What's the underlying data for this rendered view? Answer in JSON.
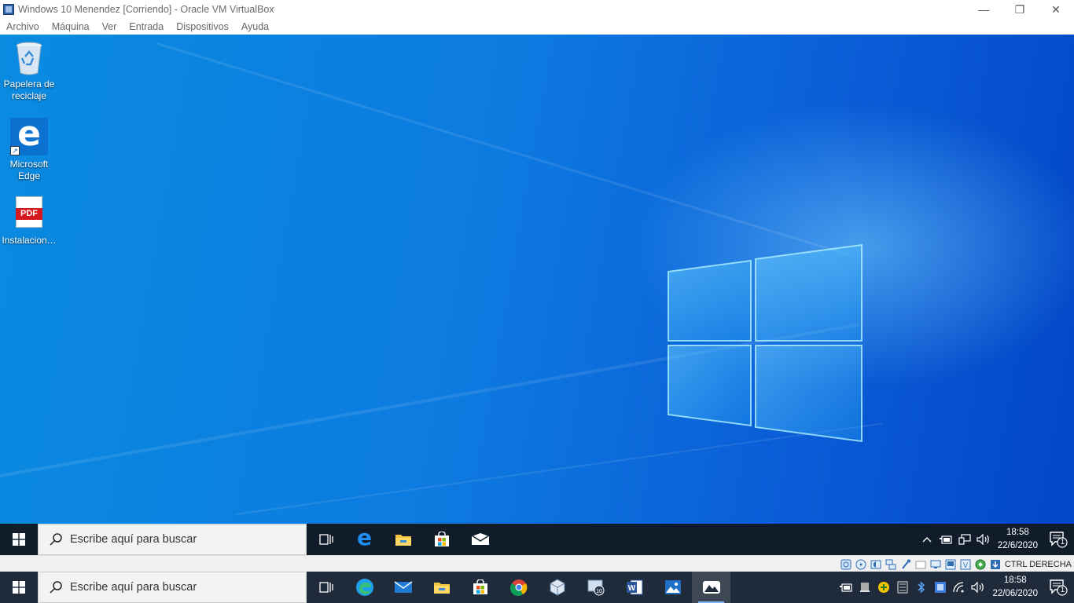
{
  "window": {
    "title": "Windows 10 Menendez [Corriendo] - Oracle VM VirtualBox",
    "controls": {
      "minimize": "—",
      "restore": "❐",
      "close": "✕"
    }
  },
  "menu": {
    "items": [
      "Archivo",
      "Máquina",
      "Ver",
      "Entrada",
      "Dispositivos",
      "Ayuda"
    ]
  },
  "desktop": {
    "icons": [
      {
        "label_line1": "Papelera de",
        "label_line2": "reciclaje",
        "icon": "recycle-bin-icon"
      },
      {
        "label_line1": "Microsoft",
        "label_line2": "Edge",
        "icon": "edge-icon"
      },
      {
        "label_line1": "Instalacion…",
        "label_line2": "",
        "icon": "pdf-icon",
        "badge": "PDF"
      }
    ],
    "colors": {
      "accent": "#0a78e0"
    }
  },
  "guest_taskbar": {
    "search_placeholder": "Escribe aquí para buscar",
    "apps": [
      "task-view-icon",
      "edge-icon",
      "file-explorer-icon",
      "store-icon",
      "mail-icon"
    ],
    "time": "18:58",
    "date": "22/6/2020",
    "notifications": "1"
  },
  "statusbar": {
    "host_key": "CTRL DERECHA"
  },
  "host_taskbar": {
    "search_placeholder": "Escribe aquí para buscar",
    "apps": [
      "task-view-icon",
      "edge-chromium-icon",
      "mail-icon",
      "file-explorer-icon",
      "store-icon",
      "chrome-icon",
      "virtualbox-icon",
      "windows10-media-icon",
      "word-icon",
      "photos-icon",
      "vm-running-icon"
    ],
    "time": "18:58",
    "date": "22/06/2020",
    "notifications": "1"
  }
}
